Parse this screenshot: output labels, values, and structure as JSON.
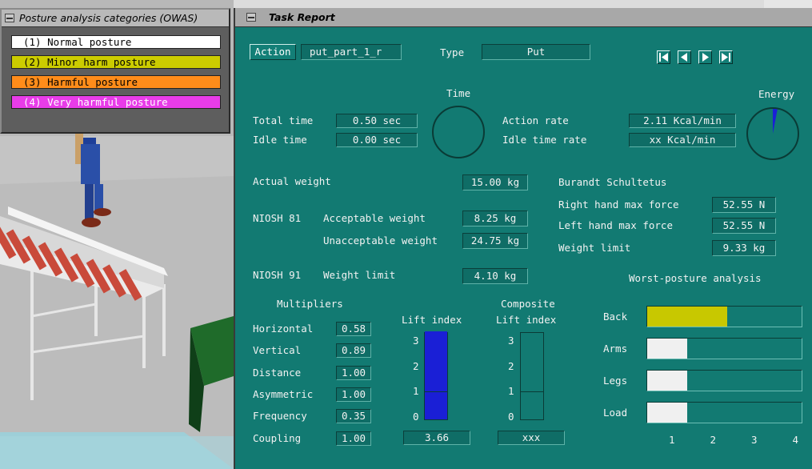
{
  "colors": {
    "panel_teal": "#127a72",
    "normal": "#ffffff",
    "minor": "#cccc00",
    "harmful": "#ff8c1a",
    "very_harmful": "#e83ce8",
    "lift_bar": "#1a1fd6",
    "energy_wedge": "#1a1fd6",
    "back_bar": "#c8c800",
    "light_bar": "#f0f0f0"
  },
  "owas": {
    "title": "Posture analysis categories (OWAS)",
    "categories": [
      {
        "label": "(1) Normal posture",
        "color": "#ffffff",
        "text_color": "#000000"
      },
      {
        "label": "(2) Minor harm posture",
        "color": "#cccc00",
        "text_color": "#000000"
      },
      {
        "label": "(3) Harmful posture",
        "color": "#ff8c1a",
        "text_color": "#000000"
      },
      {
        "label": "(4) Very harmful posture",
        "color": "#e83ce8",
        "text_color": "#ffffff"
      }
    ]
  },
  "report": {
    "title": "Task Report",
    "action_button": "Action",
    "action_value": "put_part_1_r",
    "type_label": "Type",
    "type_value": "Put",
    "nav_icons": [
      "first-icon",
      "previous-icon",
      "next-icon",
      "last-icon"
    ],
    "time_heading": "Time",
    "energy_heading": "Energy",
    "total_time_label": "Total time",
    "total_time_value": "0.50 sec",
    "idle_time_label": "Idle time",
    "idle_time_value": "0.00 sec",
    "action_rate_label": "Action rate",
    "action_rate_value": "2.11 Kcal/min",
    "idle_time_rate_label": "Idle time rate",
    "idle_time_rate_value": "xx  Kcal/min",
    "energy_fraction": 0.03,
    "actual_weight_label": "Actual weight",
    "actual_weight_value": "15.00 kg",
    "niosh81_label": "NIOSH 81",
    "acceptable_weight_label": "Acceptable weight",
    "acceptable_weight_value": "8.25 kg",
    "unacceptable_weight_label": "Unacceptable weight",
    "unacceptable_weight_value": "24.75 kg",
    "niosh91_label": "NIOSH 91",
    "niosh91_weight_limit_label": "Weight limit",
    "niosh91_weight_limit_value": "4.10 kg",
    "burandt_heading": "Burandt Schultetus",
    "right_hand_label": "Right hand max force",
    "right_hand_value": "52.55 N",
    "left_hand_label": "Left hand max force",
    "left_hand_value": "52.55 N",
    "burandt_weight_limit_label": "Weight limit",
    "burandt_weight_limit_value": "9.33 kg",
    "multipliers_heading": "Multipliers",
    "multipliers": [
      {
        "label": "Horizontal",
        "value": "0.58"
      },
      {
        "label": "Vertical",
        "value": "0.89"
      },
      {
        "label": "Distance",
        "value": "1.00"
      },
      {
        "label": "Asymmetric",
        "value": "1.00"
      },
      {
        "label": "Frequency",
        "value": "0.35"
      },
      {
        "label": "Coupling",
        "value": "1.00"
      }
    ],
    "lift_index_heading": "Lift index",
    "lift_index_ticks": [
      "3",
      "2",
      "1",
      "0"
    ],
    "lift_index_value": "3.66",
    "lift_index_level": 3.66,
    "composite_heading": "Composite",
    "composite_lift_heading": "Lift index",
    "composite_ticks": [
      "3",
      "2",
      "1",
      "0"
    ],
    "composite_value": "xxx",
    "composite_level": 0,
    "worst_posture_heading": "Worst-posture analysis",
    "posture_bars": [
      {
        "label": "Back",
        "level": 2,
        "color": "#c8c800"
      },
      {
        "label": "Arms",
        "level": 1,
        "color": "#f0f0f0"
      },
      {
        "label": "Legs",
        "level": 1,
        "color": "#f0f0f0"
      },
      {
        "label": "Load",
        "level": 1,
        "color": "#f0f0f0"
      }
    ],
    "posture_scale": [
      "1",
      "2",
      "3",
      "4"
    ]
  }
}
